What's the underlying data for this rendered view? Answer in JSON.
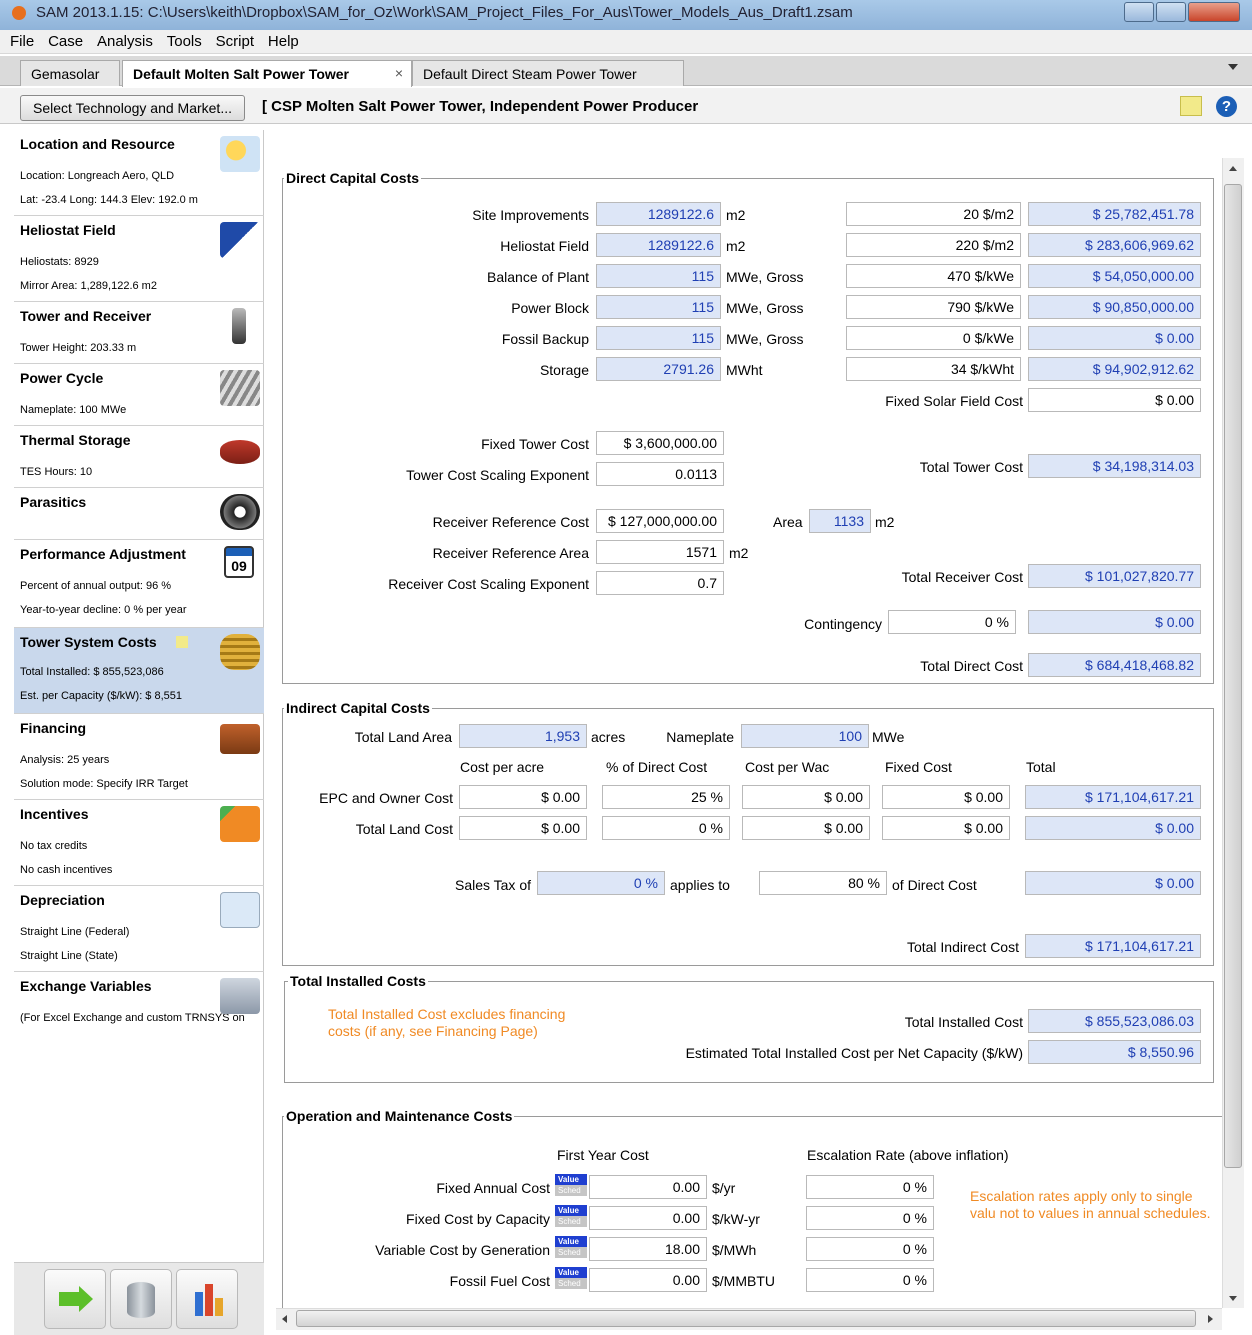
{
  "window": {
    "title": "SAM 2013.1.15: C:\\Users\\keith\\Dropbox\\SAM_for_Oz\\Work\\SAM_Project_Files_For_Aus\\Tower_Models_Aus_Draft1.zsam"
  },
  "menu": [
    "File",
    "Case",
    "Analysis",
    "Tools",
    "Script",
    "Help"
  ],
  "tabs": [
    {
      "label": "Gemasolar"
    },
    {
      "label": "Default  Molten Salt Power Tower",
      "close": "×"
    },
    {
      "label": "Default Direct Steam Power Tower"
    }
  ],
  "tech": {
    "select_label": "Select Technology and Market...",
    "title": "[ CSP Molten Salt Power Tower, Independent Power Producer"
  },
  "sidebar": [
    {
      "title": "Location and Resource",
      "lines": [
        "Location: Longreach Aero, QLD",
        "Lat: -23.4 Long: 144.3 Elev: 192.0 m"
      ],
      "icon": "weather-icon"
    },
    {
      "title": "Heliostat Field",
      "lines": [
        "Heliostats: 8929",
        "Mirror Area: 1,289,122.6 m2"
      ],
      "icon": "solar-panel-icon"
    },
    {
      "title": "Tower and Receiver",
      "lines": [
        "Tower Height: 203.33 m"
      ],
      "icon": "tower-icon"
    },
    {
      "title": "Power Cycle",
      "lines": [
        "Nameplate: 100 MWe"
      ],
      "icon": "turbine-icon"
    },
    {
      "title": "Thermal Storage",
      "lines": [
        "TES Hours: 10"
      ],
      "icon": "storage-tank-icon"
    },
    {
      "title": "Parasitics",
      "lines": [],
      "icon": "fan-icon"
    },
    {
      "title": "Performance Adjustment",
      "lines": [
        "Percent of annual output: 96 %",
        "Year-to-year decline: 0 % per year"
      ],
      "icon": "calendar-icon",
      "icon_text": "09"
    },
    {
      "title": "Tower System Costs",
      "lines": [
        "Total Installed: $ 855,523,086",
        "Est. per Capacity ($/kW): $ 8,551"
      ],
      "icon": "money-icon"
    },
    {
      "title": "Financing",
      "lines": [
        "Analysis: 25 years",
        "Solution mode: Specify IRR Target"
      ],
      "icon": "briefcase-icon"
    },
    {
      "title": "Incentives",
      "lines": [
        "No tax credits",
        "No cash incentives"
      ],
      "icon": "carrot-icon"
    },
    {
      "title": "Depreciation",
      "lines": [
        "Straight Line (Federal)",
        "Straight Line (State)"
      ],
      "icon": "curve-icon"
    },
    {
      "title": "Exchange Variables",
      "lines": [
        "(For Excel Exchange and custom TRNSYS on"
      ],
      "icon": "database-arrow-icon"
    }
  ],
  "direct": {
    "title": "Direct Capital Costs",
    "rows": [
      {
        "label": "Site Improvements",
        "qty": "1289122.6",
        "unit": "m2",
        "rate": "20 $/m2",
        "total": "$ 25,782,451.78"
      },
      {
        "label": "Heliostat Field",
        "qty": "1289122.6",
        "unit": "m2",
        "rate": "220 $/m2",
        "total": "$ 283,606,969.62"
      },
      {
        "label": "Balance of Plant",
        "qty": "115",
        "unit": "MWe, Gross",
        "rate": "470 $/kWe",
        "total": "$ 54,050,000.00"
      },
      {
        "label": "Power Block",
        "qty": "115",
        "unit": "MWe, Gross",
        "rate": "790 $/kWe",
        "total": "$ 90,850,000.00"
      },
      {
        "label": "Fossil Backup",
        "qty": "115",
        "unit": "MWe, Gross",
        "rate": "0 $/kWe",
        "total": "$ 0.00"
      },
      {
        "label": "Storage",
        "qty": "2791.26",
        "unit": "MWht",
        "rate": "34 $/kWht",
        "total": "$ 94,902,912.62"
      }
    ],
    "fixed_solar_label": "Fixed Solar Field Cost",
    "fixed_solar": "$ 0.00",
    "fixed_tower_label": "Fixed Tower Cost",
    "fixed_tower": "$ 3,600,000.00",
    "tower_exp_label": "Tower Cost Scaling Exponent",
    "tower_exp": "0.0113",
    "total_tower_label": "Total Tower Cost",
    "total_tower": "$ 34,198,314.03",
    "rec_ref_cost_label": "Receiver Reference Cost",
    "rec_ref_cost": "$ 127,000,000.00",
    "area_label": "Area",
    "area": "1133",
    "area_unit": "m2",
    "rec_ref_area_label": "Receiver Reference Area",
    "rec_ref_area": "1571",
    "rec_ref_area_unit": "m2",
    "rec_exp_label": "Receiver Cost Scaling Exponent",
    "rec_exp": "0.7",
    "total_rec_label": "Total Receiver Cost",
    "total_rec": "$ 101,027,820.77",
    "contingency_label": "Contingency",
    "contingency": "0 %",
    "contingency_total": "$ 0.00",
    "total_direct_label": "Total Direct Cost",
    "total_direct": "$ 684,418,468.82"
  },
  "indirect": {
    "title": "Indirect Capital Costs",
    "land_area_label": "Total Land Area",
    "land_area": "1,953",
    "land_area_unit": "acres",
    "nameplate_label": "Nameplate",
    "nameplate": "100",
    "nameplate_unit": "MWe",
    "columns": [
      "Cost per acre",
      "% of Direct Cost",
      "Cost per Wac",
      "Fixed Cost",
      "Total"
    ],
    "rows": [
      {
        "label": "EPC and Owner Cost",
        "values": [
          "$ 0.00",
          "25 %",
          "$ 0.00",
          "$ 0.00",
          "$ 171,104,617.21"
        ]
      },
      {
        "label": "Total Land Cost",
        "values": [
          "$ 0.00",
          "0 %",
          "$ 0.00",
          "$ 0.00",
          "$ 0.00"
        ]
      }
    ],
    "sales_tax_label": "Sales Tax of",
    "sales_tax": "0 %",
    "applies_label": "applies to",
    "applies": "80 %",
    "of_direct_label": "of Direct Cost",
    "sales_total": "$ 0.00",
    "total_indirect_label": "Total Indirect Cost",
    "total_indirect": "$ 171,104,617.21"
  },
  "installed": {
    "title": "Total Installed Costs",
    "note": "Total Installed Cost excludes financing costs (if any, see Financing Page)",
    "total_label": "Total Installed Cost",
    "total": "$ 855,523,086.03",
    "per_cap_label": "Estimated Total Installed Cost per Net Capacity ($/kW)",
    "per_cap": "$ 8,550.96"
  },
  "om": {
    "title": "Operation and Maintenance Costs",
    "first_year_label": "First Year Cost",
    "escalation_label": "Escalation Rate (above inflation)",
    "value_tag": "Value",
    "sched_tag": "Sched",
    "rows": [
      {
        "label": "Fixed Annual Cost",
        "value": "0.00",
        "unit": "$/yr",
        "esc": "0 %"
      },
      {
        "label": "Fixed Cost by Capacity",
        "value": "0.00",
        "unit": "$/kW-yr",
        "esc": "0 %"
      },
      {
        "label": "Variable Cost by Generation",
        "value": "18.00",
        "unit": "$/MWh",
        "esc": "0 %"
      },
      {
        "label": "Fossil Fuel Cost",
        "value": "0.00",
        "unit": "$/MMBTU",
        "esc": "0 %"
      }
    ],
    "note": "Escalation rates apply only to single valu not to values in annual schedules."
  },
  "colors": {
    "field_blue": "#dde6f7",
    "value_text": "#1f3fb3",
    "note_orange": "#f08a24",
    "selected_nav": "#c9d8ec"
  }
}
